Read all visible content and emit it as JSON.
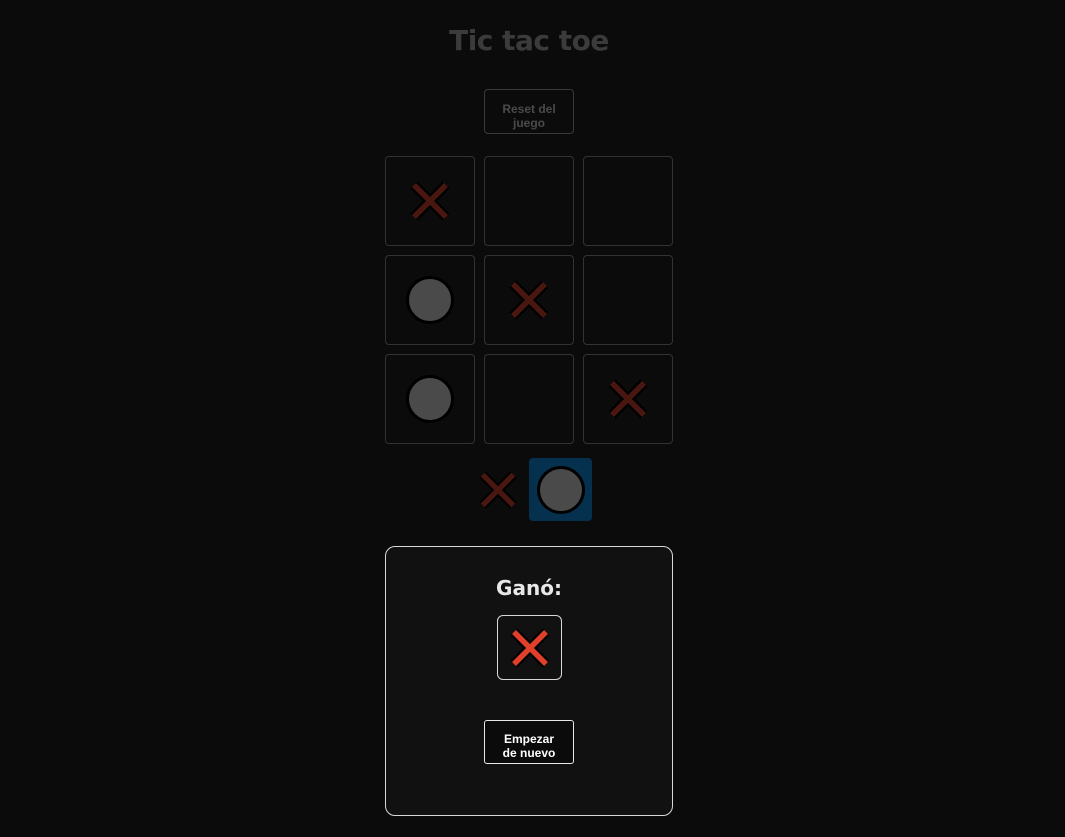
{
  "title": "Tic tac toe",
  "reset_button": "Reset del\njuego",
  "board": [
    [
      "x",
      "",
      ""
    ],
    [
      "o",
      "x",
      ""
    ],
    [
      "o",
      "",
      "x"
    ]
  ],
  "turn": {
    "players": [
      "x",
      "o"
    ],
    "active": "o"
  },
  "winner_modal": {
    "label": "Ganó:",
    "winner": "x",
    "restart_button": "Empezar\nde nuevo"
  },
  "colors": {
    "background": "#0b0b0b",
    "x_dim": "#4a1610",
    "x_bright": "#e0402a",
    "o_fill": "#4a4a4a",
    "active_turn": "#05304e",
    "modal_bg": "#111111"
  },
  "icons": {
    "x": "x-mark-icon",
    "o": "circle-icon"
  }
}
